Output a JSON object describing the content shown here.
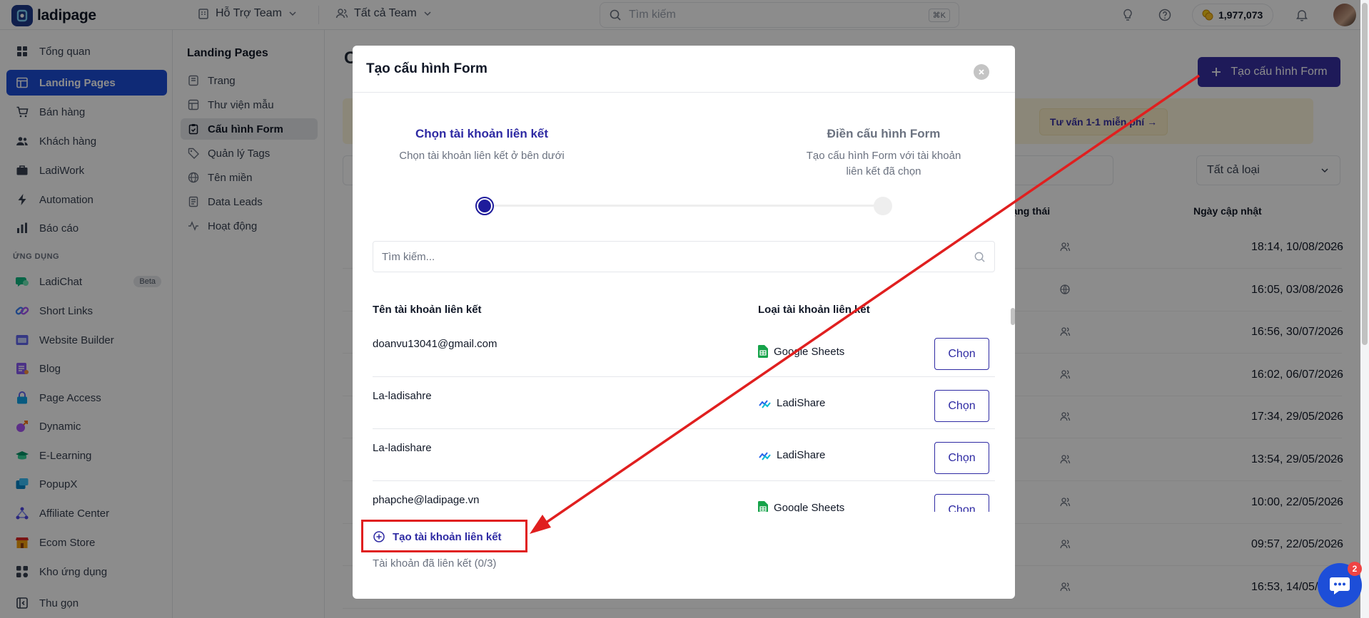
{
  "topbar": {
    "brand": "ladipage",
    "team": "Hỗ Trợ Team",
    "scope": "Tất cả Team",
    "search_placeholder": "Tìm kiếm",
    "shortcut": "⌘K",
    "credits": "1,977,073"
  },
  "sidebar": {
    "items": [
      {
        "label": "Tổng quan",
        "icon": "grid-icon"
      },
      {
        "label": "Landing Pages",
        "icon": "layout-icon",
        "active": true
      },
      {
        "label": "Bán hàng",
        "icon": "cart-icon"
      },
      {
        "label": "Khách hàng",
        "icon": "users-icon"
      },
      {
        "label": "LadiWork",
        "icon": "briefcase-icon"
      },
      {
        "label": "Automation",
        "icon": "bolt-icon"
      },
      {
        "label": "Báo cáo",
        "icon": "bar-chart-icon"
      }
    ],
    "apps_section": "ỨNG DỤNG",
    "apps": [
      {
        "label": "LadiChat",
        "badge": "Beta",
        "color": "#10b981"
      },
      {
        "label": "Short Links",
        "color": "#3b82f6"
      },
      {
        "label": "Website Builder",
        "color": "#6366f1"
      },
      {
        "label": "Blog",
        "color": "#8b5cf6"
      },
      {
        "label": "Page Access",
        "color": "#0ea5e9"
      },
      {
        "label": "Dynamic",
        "color": "#a855f7"
      },
      {
        "label": "E-Learning",
        "color": "#059669"
      },
      {
        "label": "PopupX",
        "color": "#0284c7"
      },
      {
        "label": "Affiliate Center",
        "color": "#4f46e5"
      },
      {
        "label": "Ecom Store",
        "color": "#dc2626"
      },
      {
        "label": "Kho ứng dụng",
        "color": "#374151"
      }
    ],
    "collapse": "Thu gọn"
  },
  "subnav": {
    "title": "Landing Pages",
    "items": [
      {
        "label": "Trang"
      },
      {
        "label": "Thư viện mẫu"
      },
      {
        "label": "Cấu hình Form",
        "active": true
      },
      {
        "label": "Quản lý Tags"
      },
      {
        "label": "Tên miền"
      },
      {
        "label": "Data Leads"
      },
      {
        "label": "Hoạt động"
      }
    ]
  },
  "main": {
    "heading": "C",
    "create_button": "Tạo cấu hình Form",
    "advice_link": "Tư vấn 1-1 miễn phí →",
    "type_filter": "Tất cả loại",
    "col_status": "rạng thái",
    "col_updated": "Ngày cập nhật",
    "rows": [
      {
        "date": "18:14, 10/08/2026"
      },
      {
        "date": "16:05, 03/08/2026"
      },
      {
        "date": "16:56, 30/07/2026"
      },
      {
        "date": "16:02, 06/07/2026"
      },
      {
        "date": "17:34, 29/05/2026"
      },
      {
        "date": "13:54, 29/05/2026"
      },
      {
        "date": "10:00, 22/05/2026"
      },
      {
        "date": "09:57, 22/05/2026"
      },
      {
        "date": "16:53, 14/05/2026"
      }
    ]
  },
  "modal": {
    "title": "Tạo cấu hình Form",
    "step1_title": "Chọn tài khoản liên kết",
    "step1_desc": "Chọn tài khoản liên kết ở bên dưới",
    "step2_title": "Điền cấu hình Form",
    "step2_desc": "Tạo cấu hình Form với tài khoản liên kết đã chọn",
    "search_placeholder": "Tìm kiếm...",
    "col_name": "Tên tài khoản liên kết",
    "col_type": "Loại tài khoản liên kết",
    "accounts": [
      {
        "name": "doanvu13041@gmail.com",
        "type": "Google Sheets",
        "action": "Chọn"
      },
      {
        "name": "La-ladisahre",
        "type": "LadiShare",
        "action": "Chọn"
      },
      {
        "name": "La-ladishare",
        "type": "LadiShare",
        "action": "Chọn"
      },
      {
        "name": "phapche@ladipage.vn",
        "type": "Google Sheets",
        "action": "Chọn"
      }
    ],
    "create_link": "Tạo tài khoản liên kết",
    "linked_count": "Tài khoản đã liên kết (0/3)"
  },
  "chat_badge": "2",
  "colors": {
    "accent": "#2e2aa3",
    "annotation": "#e01f1f"
  }
}
